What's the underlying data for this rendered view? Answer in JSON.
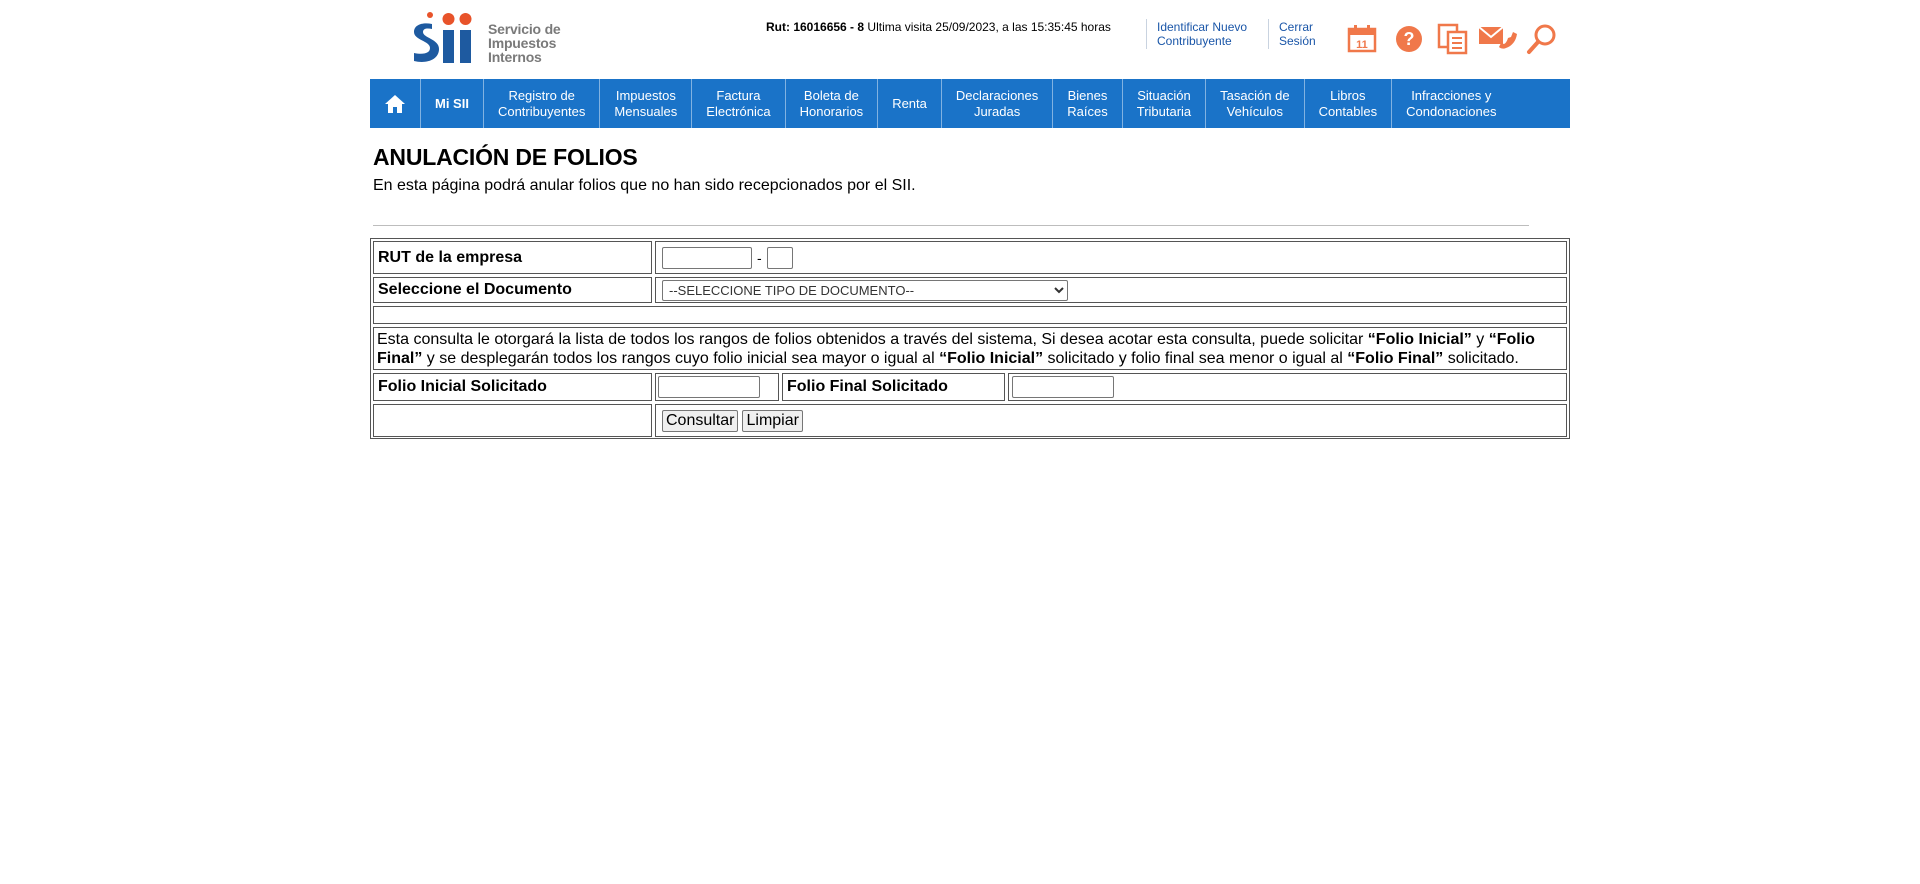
{
  "header": {
    "logo_text": [
      "Servicio de",
      "Impuestos",
      "Internos"
    ],
    "logo_word": "SII",
    "rut_label": "Rut: 16016656 - 8",
    "last_visit": "Ultima visita 25/09/2023, a las 15:35:45 horas",
    "identify_link": [
      "Identificar Nuevo",
      "Contribuyente"
    ],
    "logout_link": [
      "Cerrar",
      "Sesión"
    ],
    "icons": [
      "calendar-icon",
      "help-icon",
      "documents-icon",
      "contact-icon",
      "search-icon"
    ],
    "calendar_day": "11"
  },
  "nav": {
    "home_icon": "home-icon",
    "items": [
      {
        "line1": "Mi SII",
        "line2": "",
        "bold": true
      },
      {
        "line1": "Registro de",
        "line2": "Contribuyentes"
      },
      {
        "line1": "Impuestos",
        "line2": "Mensuales"
      },
      {
        "line1": "Factura",
        "line2": "Electrónica"
      },
      {
        "line1": "Boleta de",
        "line2": "Honorarios"
      },
      {
        "line1": "Renta",
        "line2": ""
      },
      {
        "line1": "Declaraciones",
        "line2": "Juradas"
      },
      {
        "line1": "Bienes",
        "line2": "Raíces"
      },
      {
        "line1": "Situación",
        "line2": "Tributaria"
      },
      {
        "line1": "Tasación de",
        "line2": "Vehículos"
      },
      {
        "line1": "Libros",
        "line2": "Contables"
      },
      {
        "line1": "Infracciones y",
        "line2": "Condonaciones"
      }
    ]
  },
  "page": {
    "title": "ANULACIÓN DE FOLIOS",
    "description": "En esta página podrá anular folios que no han sido recepcionados por el SII."
  },
  "form": {
    "rut_label": "RUT de la empresa",
    "rut_value": "",
    "rut_dv_value": "",
    "rut_dash": "-",
    "doc_label": "Seleccione el Documento",
    "doc_selected": "--SELECCIONE TIPO DE DOCUMENTO--",
    "info_parts": [
      {
        "t": "Esta consulta le otorgará la lista de todos los rangos de folios obtenidos a través del sistema, Si desea acotar esta consulta, puede solicitar ",
        "b": false
      },
      {
        "t": "“Folio Inicial”",
        "b": true
      },
      {
        "t": " y ",
        "b": false
      },
      {
        "t": "“Folio Final”",
        "b": true
      },
      {
        "t": " y se desplegarán todos los rangos cuyo folio inicial sea mayor o igual al ",
        "b": false
      },
      {
        "t": "“Folio Inicial”",
        "b": true
      },
      {
        "t": " solicitado y folio final sea menor o igual al ",
        "b": false
      },
      {
        "t": "“Folio Final”",
        "b": true
      },
      {
        "t": " solicitado.",
        "b": false
      }
    ],
    "folio_inicial_label": "Folio Inicial Solicitado",
    "folio_inicial_value": "",
    "folio_final_label": "Folio Final Solicitado",
    "folio_final_value": "",
    "consultar_button": "Consultar",
    "limpiar_button": "Limpiar"
  },
  "colors": {
    "nav_bg": "#1a73c8",
    "link": "#1a56a8",
    "icon_orange": "#f0784a",
    "logo_blue": "#1e5aa0",
    "logo_orange": "#e8532a"
  }
}
